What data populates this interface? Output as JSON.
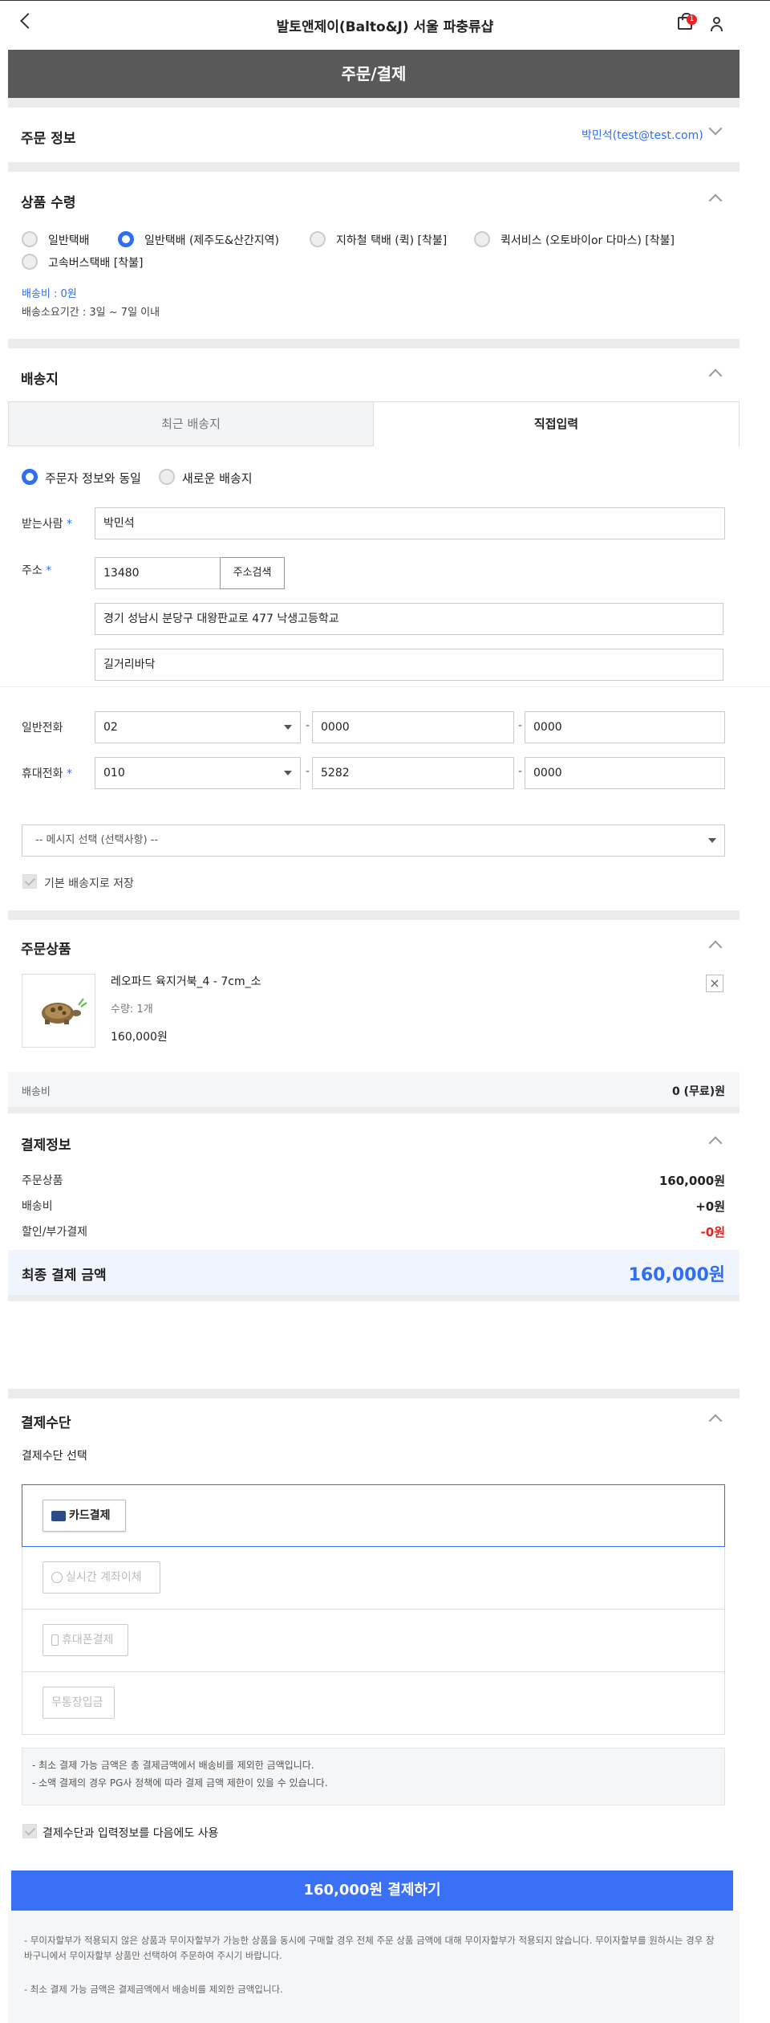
{
  "header": {
    "title": "발토앤제이(Balto&J) 서울 파충류샵",
    "cart_count": "1"
  },
  "page_title": "주문/결제",
  "order_info": {
    "title": "주문 정보",
    "orderer": "박민석(test@test.com)"
  },
  "delivery_method": {
    "title": "상품 수령",
    "options": [
      {
        "label": "일반택배",
        "selected": false
      },
      {
        "label": "일반택배 (제주도&산간지역)",
        "selected": true
      },
      {
        "label": "지하철 택배 (퀵) [착불]",
        "selected": false
      },
      {
        "label": "퀵서비스 (오토바이or 다마스) [착불]",
        "selected": false
      },
      {
        "label": "고속버스택배 [착불]",
        "selected": false
      }
    ],
    "fee": "배송비 : 0원",
    "period": "배송소요기간 : 3일 ~ 7일 이내"
  },
  "shipping": {
    "title": "배송지",
    "tabs": [
      "최근 배송지",
      "직접입력"
    ],
    "active_tab": 1,
    "addr_choice": [
      {
        "label": "주문자 정보와 동일",
        "selected": true
      },
      {
        "label": "새로운 배송지",
        "selected": false
      }
    ],
    "recipient_label": "받는사람",
    "recipient": "박민석",
    "address_label": "주소",
    "zipcode": "13480",
    "address_search": "주소검색",
    "address1": "경기 성남시 분당구 대왕판교로 477 낙생고등학교",
    "address2": "길거리바닥",
    "phone_label": "일반전화",
    "phone": [
      "02",
      "0000",
      "0000"
    ],
    "mobile_label": "휴대전화",
    "mobile": [
      "010",
      "5282",
      "0000"
    ],
    "message_select": "-- 메시지 선택 (선택사항) --",
    "save_default": "기본 배송지로 저장",
    "required_mark": "*",
    "dash": "-"
  },
  "order_items": {
    "title": "주문상품",
    "items": [
      {
        "name": "레오파드 육지거북_4 - 7cm_소",
        "qty": "수량: 1개",
        "price": "160,000원"
      }
    ],
    "shipping_label": "배송비",
    "shipping_value": "0 (무료)원"
  },
  "payment_info": {
    "title": "결제정보",
    "rows": [
      {
        "label": "주문상품",
        "value": "160,000원"
      },
      {
        "label": "배송비",
        "value": "+0원"
      },
      {
        "label": "할인/부가결제",
        "value": "-0원"
      }
    ],
    "total_label": "최종 결제 금액",
    "total_value": "160,000원"
  },
  "payment_method": {
    "title": "결제수단",
    "subtitle": "결제수단 선택",
    "methods": [
      "카드결제",
      "실시간 계좌이체",
      "휴대폰결제",
      "무통장입금"
    ],
    "notes": [
      "- 최소 결제 가능 금액은 총 결제금액에서 배송비를 제외한 금액입니다.",
      "- 소액 결제의 경우 PG사 정책에 따라 결제 금액 제한이 있을 수 있습니다."
    ],
    "remember": "결제수단과 입력정보를 다음에도 사용"
  },
  "pay_button": "160,000원 결제하기",
  "footer_notes": [
    "- 무이자할부가 적용되지 않은 상품과 무이자할부가 가능한 상품을 동시에 구매할 경우 전체 주문 상품 금액에 대해 무이자할부가 적용되지 않습니다. 무이자할부를 원하시는 경우 장바구니에서 무이자할부 상품만 선택하여 주문하여 주시기 바랍니다.",
    "- 최소 결제 가능 금액은 결제금액에서 배송비를 제외한 금액입니다."
  ],
  "colors": {
    "accent": "#2e6ef5",
    "header_bg": "#595959",
    "pay_button": "#3a70f5",
    "discount": "#e22222"
  }
}
